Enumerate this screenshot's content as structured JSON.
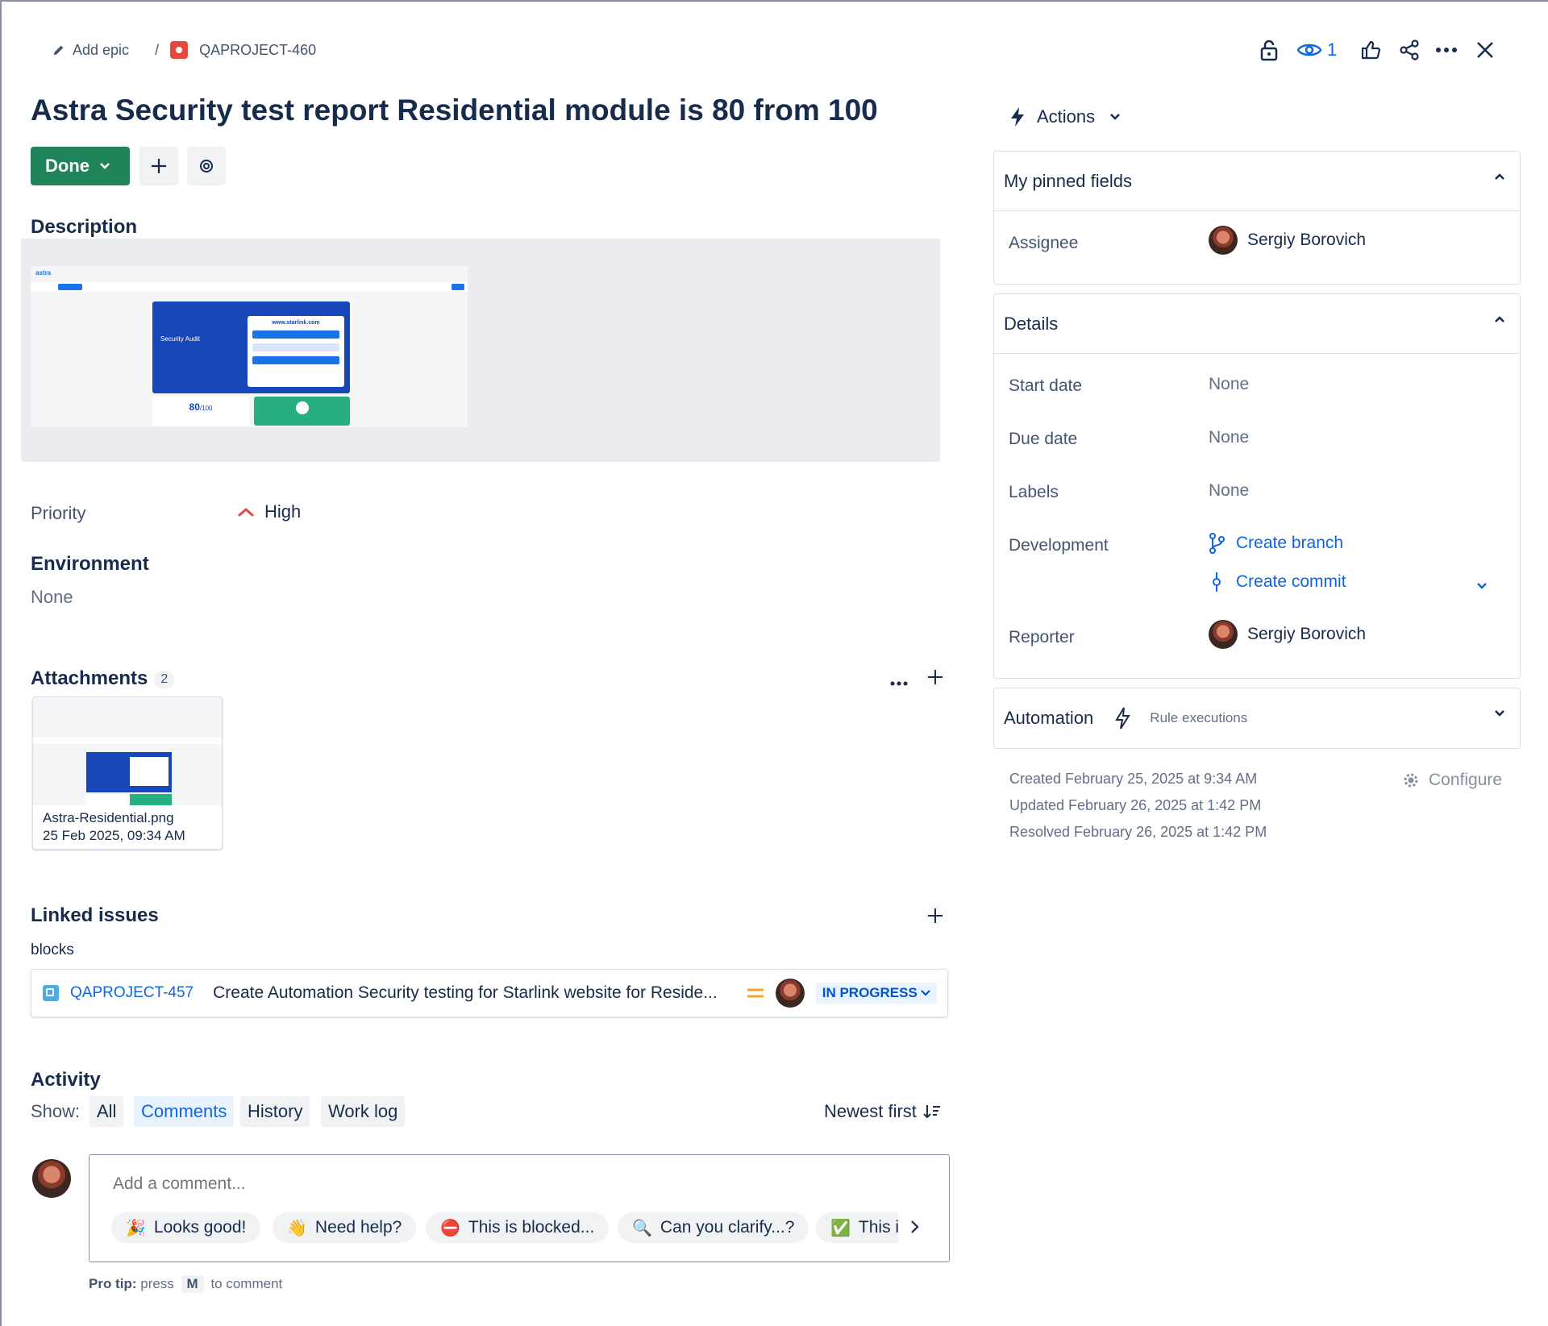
{
  "breadcrumb": {
    "add_epic": "Add epic",
    "separator": "/",
    "issue_key": "QAPROJECT-460"
  },
  "header": {
    "watch_count": "1"
  },
  "issue": {
    "title": "Astra Security test report Residential module is 80 from 100",
    "status_button": "Done"
  },
  "description": {
    "heading": "Description",
    "image": {
      "brand": "astra",
      "url": "www.starlink.com",
      "card_title": "Security Audit",
      "score": "80",
      "score_max": "/100"
    }
  },
  "priority": {
    "label": "Priority",
    "value": "High",
    "color": "#e2483d"
  },
  "environment": {
    "heading": "Environment",
    "value": "None"
  },
  "attachments": {
    "heading": "Attachments",
    "count": "2",
    "items": [
      {
        "name": "Astra-Residential.png",
        "date": "25 Feb 2025, 09:34 AM"
      }
    ]
  },
  "linked_issues": {
    "heading": "Linked issues",
    "relation": "blocks",
    "items": [
      {
        "key": "QAPROJECT-457",
        "summary": "Create Automation Security testing for Starlink website for Reside...",
        "status": "IN PROGRESS",
        "priority_color": "#f5a623"
      }
    ]
  },
  "activity": {
    "heading": "Activity",
    "show_label": "Show:",
    "tabs": [
      "All",
      "Comments",
      "History",
      "Work log"
    ],
    "selected_tab": "Comments",
    "sort": "Newest first",
    "comment_placeholder": "Add a comment...",
    "chips": [
      {
        "emoji": "🎉",
        "label": "Looks good!"
      },
      {
        "emoji": "👋",
        "label": "Need help?"
      },
      {
        "emoji": "⛔",
        "label": "This is blocked..."
      },
      {
        "emoji": "🔍",
        "label": "Can you clarify...?"
      },
      {
        "emoji": "✅",
        "label": "This i"
      }
    ],
    "pro_tip_label": "Pro tip:",
    "pro_tip_press": "press",
    "pro_tip_key": "M",
    "pro_tip_rest": "to comment"
  },
  "sidebar": {
    "actions_label": "Actions",
    "pinned": {
      "title": "My pinned fields",
      "assignee_label": "Assignee",
      "assignee": "Sergiy Borovich"
    },
    "details": {
      "title": "Details",
      "start_date_label": "Start date",
      "start_date": "None",
      "due_date_label": "Due date",
      "due_date": "None",
      "labels_label": "Labels",
      "labels": "None",
      "development_label": "Development",
      "create_branch": "Create branch",
      "create_commit": "Create commit",
      "reporter_label": "Reporter",
      "reporter": "Sergiy Borovich"
    },
    "automation": {
      "title": "Automation",
      "rule_executions": "Rule executions"
    },
    "created": "Created February 25, 2025 at 9:34 AM",
    "updated": "Updated February 26, 2025 at 1:42 PM",
    "resolved": "Resolved February 26, 2025 at 1:42 PM",
    "configure": "Configure"
  },
  "colors": {
    "done_green": "#1f845a",
    "link_blue": "#0c66e4",
    "text": "#172b4d"
  }
}
